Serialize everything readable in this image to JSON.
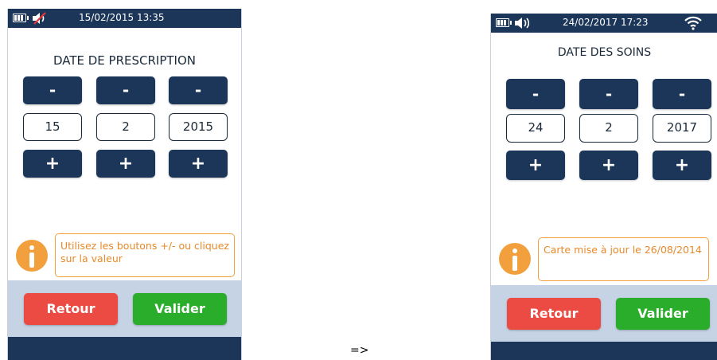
{
  "arrow": "=>",
  "screen1": {
    "datetime": "15/02/2015 13:35",
    "title": "DATE DE PRESCRIPTION",
    "minus_label": "-",
    "plus_label": "+",
    "day": "15",
    "month": "2",
    "year": "2015",
    "info_message": "Utilisez les boutons +/- ou cliquez sur la valeur",
    "back_label": "Retour",
    "validate_label": "Valider",
    "icons": [
      "battery-icon",
      "speaker-muted-icon",
      "info-icon"
    ]
  },
  "screen2": {
    "datetime": "24/02/2017 17:23",
    "title": "DATE DES SOINS",
    "minus_label": "-",
    "plus_label": "+",
    "day": "24",
    "month": "2",
    "year": "2017",
    "info_message": "Carte mise à jour le 26/08/2014",
    "back_label": "Retour",
    "validate_label": "Valider",
    "icons": [
      "battery-icon",
      "speaker-icon",
      "wifi-icon",
      "info-icon"
    ]
  },
  "colors": {
    "navy": "#1b3659",
    "footer": "#c5d3e5",
    "back": "#ec4b44",
    "validate": "#2aad2a",
    "info": "#f2a03d"
  }
}
